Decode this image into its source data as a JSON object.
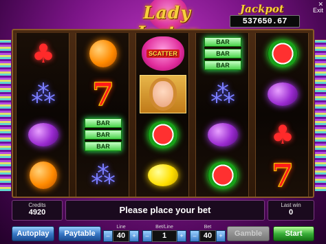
{
  "header": {
    "logo_text": "Lady Jester",
    "jackpot_label": "Jackpot",
    "jackpot_value": "537650.67",
    "exit_label": "Exit",
    "exit_icon": "close-x"
  },
  "reels": [
    [
      "cherry",
      "grapes",
      "plum",
      "orange"
    ],
    [
      "orange",
      "seven",
      "bar",
      "grapes"
    ],
    [
      "scatter",
      "lady-jester",
      "watermelon",
      "lemon"
    ],
    [
      "bar",
      "grapes",
      "plum",
      "watermelon"
    ],
    [
      "watermelon",
      "plum",
      "cherry",
      "seven"
    ]
  ],
  "symbols": {
    "seven_text": "7",
    "bar_text": "BAR",
    "scatter_text": "SCATTER"
  },
  "panel": {
    "credits_label": "Credits",
    "credits_value": "4920",
    "message": "Please place your bet",
    "last_win_label": "Last win",
    "last_win_value": "0"
  },
  "controls": {
    "autoplay_label": "Autoplay",
    "paytable_label": "Paytable",
    "line_label": "Line",
    "line_value": "40",
    "betline_label": "Bet/Line",
    "betline_value": "1",
    "bet_label": "Bet",
    "bet_value": "40",
    "gamble_label": "Gamble",
    "start_label": "Start",
    "minus": "–",
    "plus": "+"
  }
}
